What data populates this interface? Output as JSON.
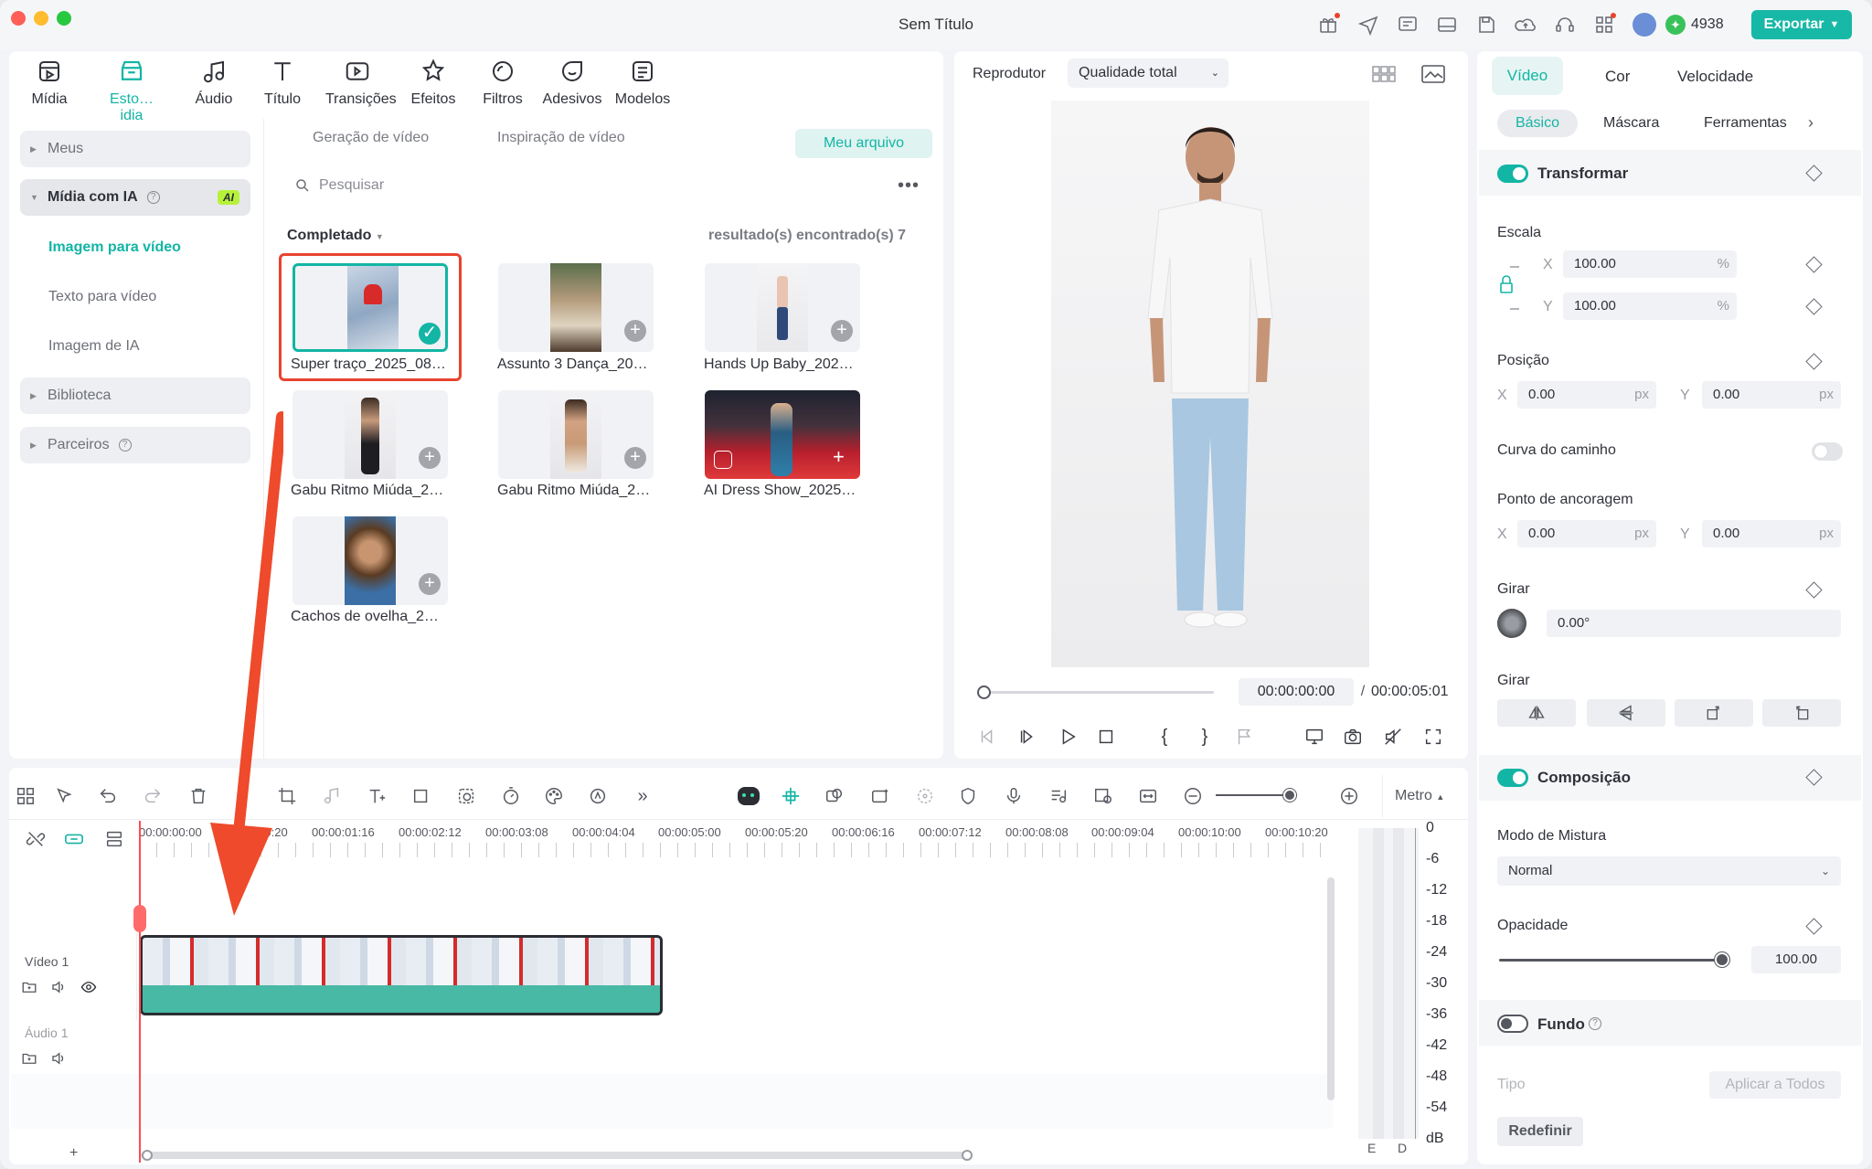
{
  "window": {
    "title": "Sem Título"
  },
  "topbar": {
    "credits": "4938",
    "export_label": "Exportar"
  },
  "toolbar": {
    "items": [
      {
        "label": "Mídia",
        "icon": "media-icon"
      },
      {
        "label": "Esto…idia",
        "icon": "stock-media-icon"
      },
      {
        "label": "Áudio",
        "icon": "music-note-icon"
      },
      {
        "label": "Título",
        "icon": "title-text-icon"
      },
      {
        "label": "Transições",
        "icon": "transitions-icon"
      },
      {
        "label": "Efeitos",
        "icon": "effects-star-icon"
      },
      {
        "label": "Filtros",
        "icon": "filters-icon"
      },
      {
        "label": "Adesivos",
        "icon": "stickers-icon"
      },
      {
        "label": "Modelos",
        "icon": "templates-icon"
      }
    ]
  },
  "sidebar": {
    "meus": "Meus",
    "midia_ia": "Mídia com IA",
    "ai_badge": "AI",
    "sub": [
      "Imagem para vídeo",
      "Texto para vídeo",
      "Imagem de IA"
    ],
    "biblioteca": "Biblioteca",
    "parceiros": "Parceiros"
  },
  "library": {
    "tab_gen": "Geração de vídeo",
    "tab_insp": "Inspiração de vídeo",
    "my_file": "Meu arquivo",
    "search_placeholder": "Pesquisar",
    "filter": "Completado",
    "results": "resultado(s) encontrado(s) 7",
    "items": [
      "Super traço_2025_08…",
      "Assunto 3 Dança_20…",
      "Hands Up Baby_202…",
      "Gabu Ritmo Miúda_2…",
      "Gabu Ritmo Miúda_2…",
      "AI Dress Show_2025…",
      "Cachos de ovelha_2…"
    ]
  },
  "player": {
    "label": "Reprodutor",
    "quality": "Qualidade total",
    "current_time": "00:00:00:00",
    "separator": "/",
    "total_time": "00:00:05:01",
    "progress": 0
  },
  "timeline": {
    "meter_label": "Metro",
    "ruler": [
      "00:00:00:00",
      "00:00:00:20",
      "00:00:01:16",
      "00:00:02:12",
      "00:00:03:08",
      "00:00:04:04",
      "00:00:05:00",
      "00:00:05:20",
      "00:00:06:16",
      "00:00:07:12",
      "00:00:08:08",
      "00:00:09:04",
      "00:00:10:00",
      "00:00:10:20"
    ],
    "video_track": "Vídeo 1",
    "audio_track": "Áudio 1",
    "add": "+",
    "db_scale": [
      "0",
      "-6",
      "-12",
      "-18",
      "-24",
      "-30",
      "-36",
      "-42",
      "-48",
      "-54",
      "dB"
    ],
    "channels": [
      "E",
      "D"
    ]
  },
  "right_panel": {
    "tabs": [
      "Vídeo",
      "Cor",
      "Velocidade"
    ],
    "subtabs": [
      "Básico",
      "Máscara",
      "Ferramentas"
    ],
    "transform": "Transformar",
    "scale": "Escala",
    "scale_x": "100.00",
    "scale_y": "100.00",
    "percent": "%",
    "position": "Posição",
    "pos_x": "0.00",
    "pos_y": "0.00",
    "px": "px",
    "path_curve": "Curva do caminho",
    "anchor": "Ponto de ancoragem",
    "anchor_x": "0.00",
    "anchor_y": "0.00",
    "rotate": "Girar",
    "rotate_value": "0.00°",
    "flip": "Girar",
    "x": "X",
    "y": "Y",
    "composition": "Composição",
    "blend_mode": "Modo de Mistura",
    "blend_value": "Normal",
    "opacity": "Opacidade",
    "opacity_value": "100.00",
    "background": "Fundo",
    "type": "Tipo",
    "apply_all": "Aplicar a Todos",
    "reset": "Redefinir"
  },
  "colors": {
    "accent": "#13b5a5",
    "highlight_red": "#e8432e",
    "export_bg": "#17b8a6"
  }
}
